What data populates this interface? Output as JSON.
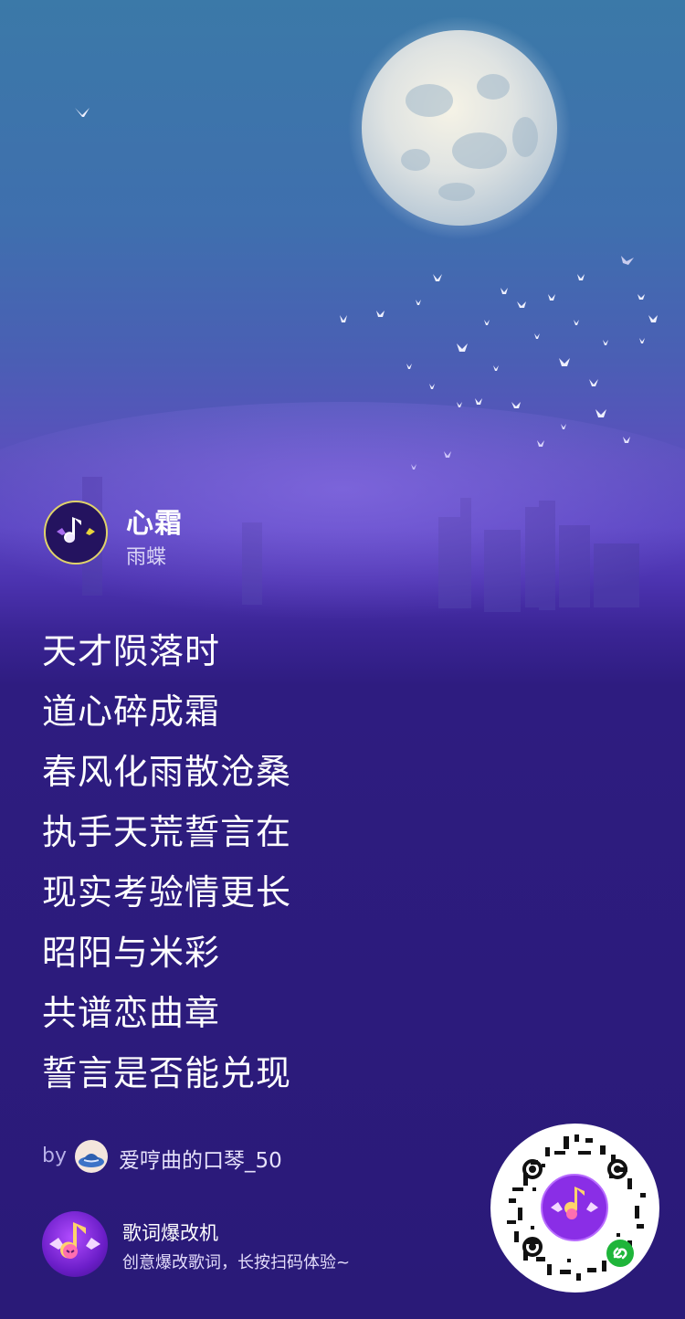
{
  "song": {
    "title": "心霜",
    "artist": "雨蝶"
  },
  "lyrics": [
    "天才陨落时",
    "道心碎成霜",
    "春风化雨散沧桑",
    "执手天荒誓言在",
    "现实考验情更长",
    "昭阳与米彩",
    "共谱恋曲章",
    "誓言是否能兑现"
  ],
  "credit": {
    "prefix": "by",
    "username": "爱哼曲的口琴_50"
  },
  "app": {
    "name": "歌词爆改机",
    "description": "创意爆改歌词，长按扫码体验~"
  },
  "colors": {
    "background": "#2a1a78",
    "sky_top": "#3b79a8",
    "accent_ring": "#e0d36a",
    "qr_badge": "#1fb53a"
  },
  "icons": {
    "header_logo": "music-note-wings-icon",
    "app_logo": "music-note-wings-icon",
    "qr_badge": "link-icon"
  }
}
